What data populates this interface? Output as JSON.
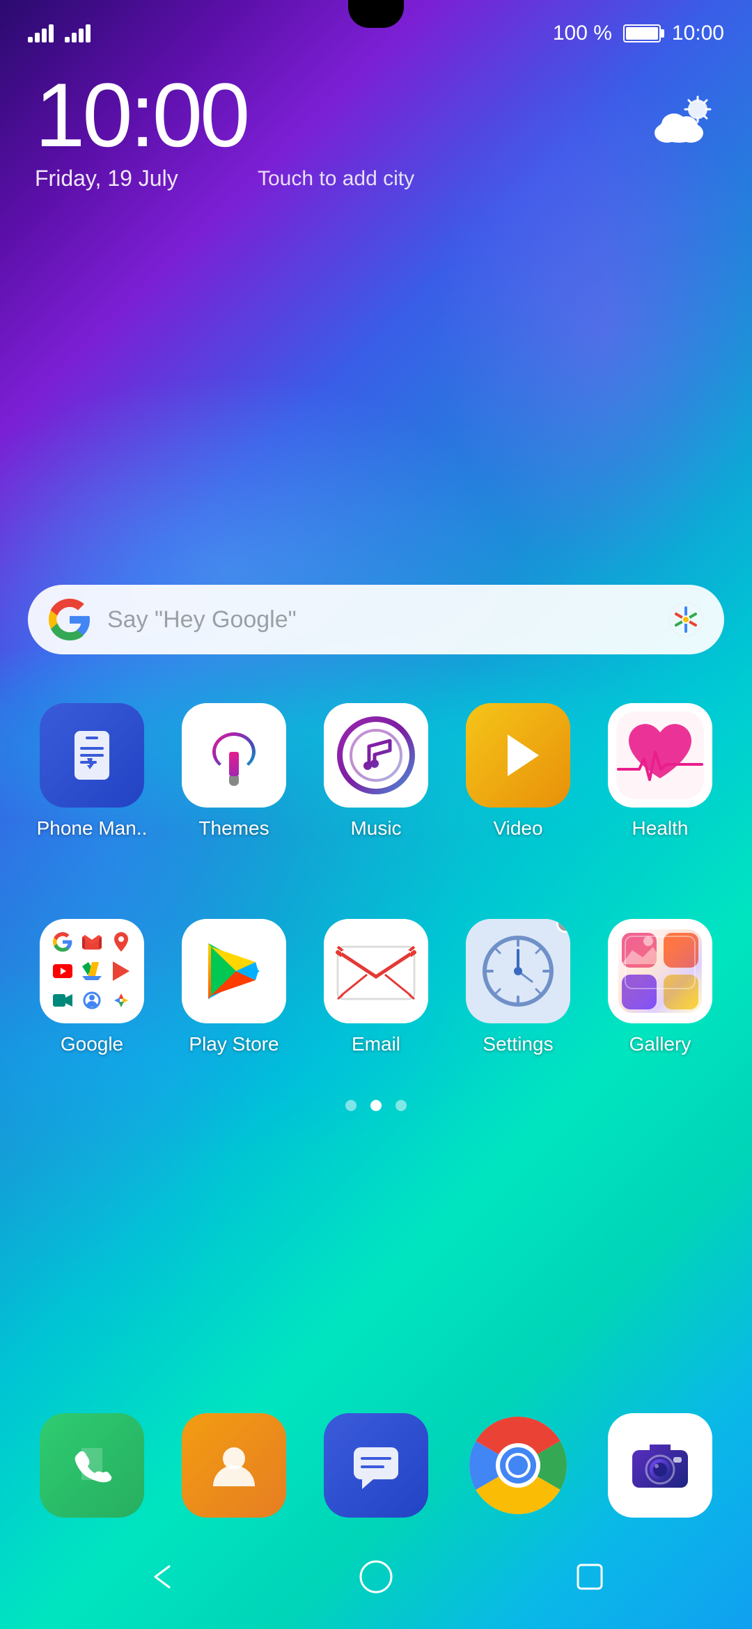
{
  "status": {
    "time": "10:00",
    "battery_percent": "100 %",
    "am_pm": ""
  },
  "clock": {
    "time": "10:00",
    "date": "Friday, 19 July",
    "touch_city": "Touch to add city"
  },
  "search": {
    "placeholder": "Say \"Hey Google\""
  },
  "apps_row1": [
    {
      "name": "Phone Man..",
      "icon": "phone-manager"
    },
    {
      "name": "Themes",
      "icon": "themes"
    },
    {
      "name": "Music",
      "icon": "music"
    },
    {
      "name": "Video",
      "icon": "video"
    },
    {
      "name": "Health",
      "icon": "health"
    }
  ],
  "apps_row2": [
    {
      "name": "Google",
      "icon": "google-folder"
    },
    {
      "name": "Play Store",
      "icon": "playstore"
    },
    {
      "name": "Email",
      "icon": "email"
    },
    {
      "name": "Settings",
      "icon": "settings"
    },
    {
      "name": "Gallery",
      "icon": "gallery"
    }
  ],
  "dock": [
    {
      "name": "Phone",
      "icon": "phone"
    },
    {
      "name": "Contacts",
      "icon": "contacts"
    },
    {
      "name": "Messages",
      "icon": "messages"
    },
    {
      "name": "Chrome",
      "icon": "chrome"
    },
    {
      "name": "Camera",
      "icon": "camera"
    }
  ],
  "nav": {
    "back": "◁",
    "home": "○",
    "recent": "□"
  },
  "page_dots": [
    {
      "active": false
    },
    {
      "active": true
    },
    {
      "active": false
    }
  ]
}
